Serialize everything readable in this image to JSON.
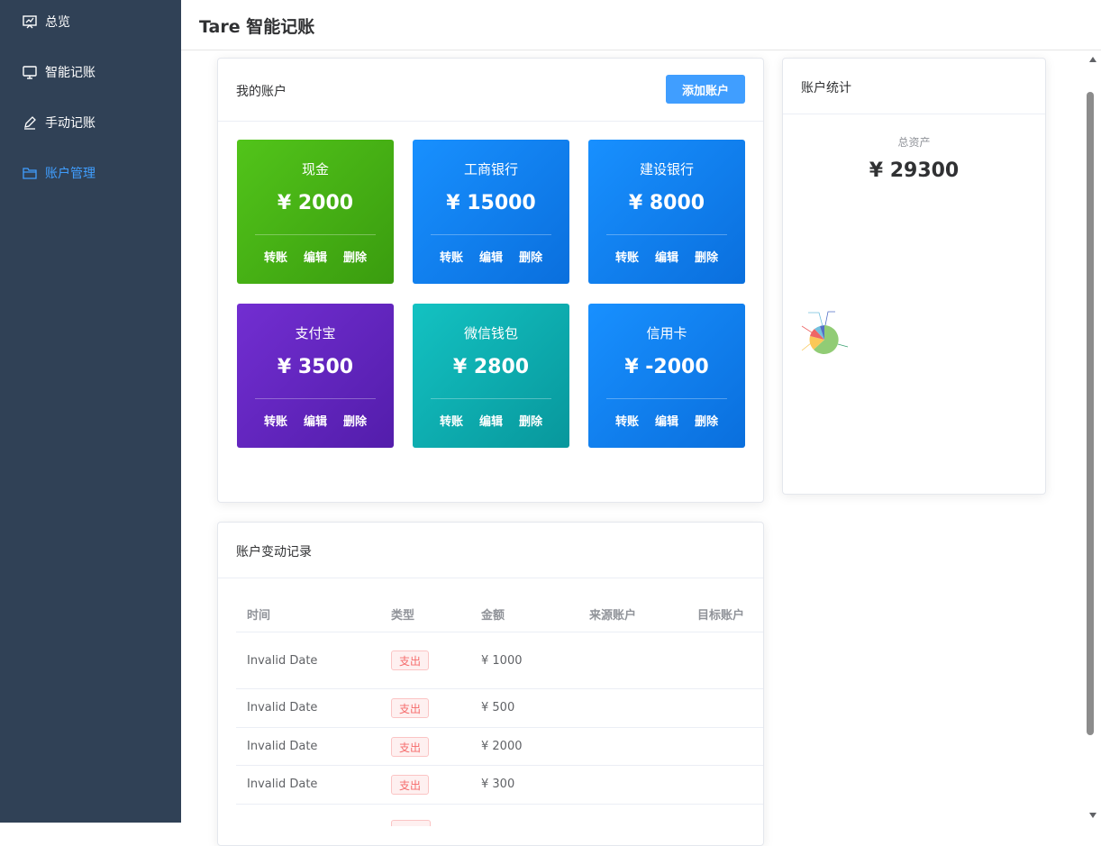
{
  "sidebar": {
    "items": [
      {
        "label": "总览",
        "icon": "presentation-chart-icon"
      },
      {
        "label": "智能记账",
        "icon": "monitor-icon"
      },
      {
        "label": "手动记账",
        "icon": "pen-icon"
      },
      {
        "label": "账户管理",
        "icon": "folder-icon"
      }
    ],
    "active_color": "#409eff",
    "background": "#304156"
  },
  "header": {
    "title": "Tare 智能记账"
  },
  "my_accounts": {
    "title": "我的账户",
    "add_button": "添加账户",
    "accounts": [
      {
        "name": "现金",
        "balance": "¥ 2000",
        "transfer": "转账",
        "edit": "编辑",
        "delete": "删除"
      },
      {
        "name": "工商银行",
        "balance": "¥ 15000",
        "transfer": "转账",
        "edit": "编辑",
        "delete": "删除"
      },
      {
        "name": "建设银行",
        "balance": "¥ 8000",
        "transfer": "转账",
        "edit": "编辑",
        "delete": "删除"
      },
      {
        "name": "支付宝",
        "balance": "¥ 3500",
        "transfer": "转账",
        "edit": "编辑",
        "delete": "删除"
      },
      {
        "name": "微信钱包",
        "balance": "¥ 2800",
        "transfer": "转账",
        "edit": "编辑",
        "delete": "删除"
      },
      {
        "name": "信用卡",
        "balance": "¥ -2000",
        "transfer": "转账",
        "edit": "编辑",
        "delete": "删除"
      }
    ]
  },
  "stats": {
    "title": "账户统计",
    "total_label": "总资产",
    "total_value": "¥ 29300",
    "pie_colors": [
      "#91cc75",
      "#fac858",
      "#ee6666",
      "#73c0de",
      "#5470c6",
      "#3ba272"
    ]
  },
  "records": {
    "title": "账户变动记录",
    "columns": [
      "时间",
      "类型",
      "金额",
      "来源账户",
      "目标账户"
    ],
    "rows": [
      {
        "time": "Invalid Date",
        "type": "支出",
        "amount": "¥ 1000"
      },
      {
        "time": "Invalid Date",
        "type": "支出",
        "amount": "¥ 500"
      },
      {
        "time": "Invalid Date",
        "type": "支出",
        "amount": "¥ 2000"
      },
      {
        "time": "Invalid Date",
        "type": "支出",
        "amount": "¥ 300"
      }
    ]
  }
}
